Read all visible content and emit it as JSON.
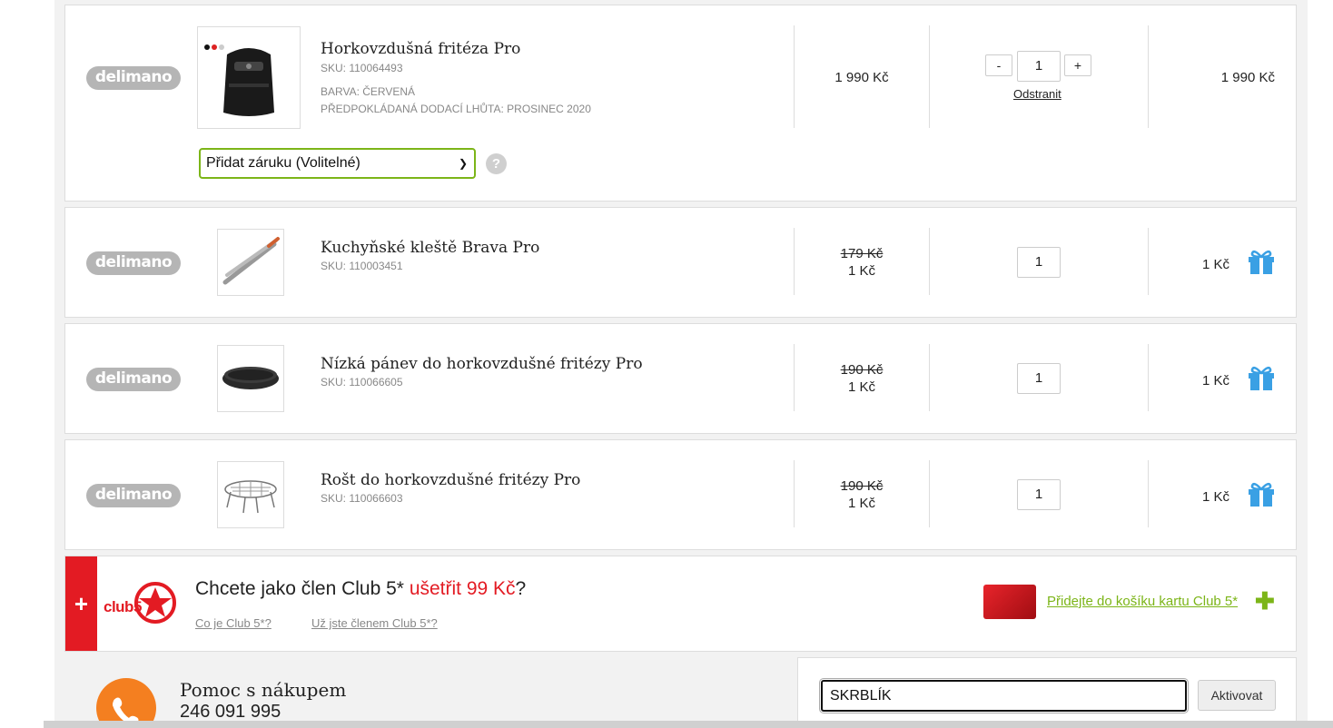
{
  "items": [
    {
      "brand": "delimano",
      "name": "Horkovzdušná fritéza Pro",
      "sku": "SKU: 110064493",
      "color": "BARVA: ČERVENÁ",
      "delivery": "PŘEDPOKLÁDANÁ DODACÍ LHŮTA: PROSINEC 2020",
      "price": "1 990 Kč",
      "qty": "1",
      "minus": "-",
      "plus": "+",
      "remove": "Odstranit",
      "total": "1 990 Kč",
      "warranty": "Přidat záruku (Volitelné)",
      "help": "?"
    },
    {
      "brand": "delimano",
      "name": "Kuchyňské kleště Brava Pro",
      "sku": "SKU: 110003451",
      "old_price": "179 Kč",
      "price": "1 Kč",
      "qty": "1",
      "total": "1 Kč"
    },
    {
      "brand": "delimano",
      "name": "Nízká pánev do horkovzdušné fritézy Pro",
      "sku": "SKU: 110066605",
      "old_price": "190 Kč",
      "price": "1 Kč",
      "qty": "1",
      "total": "1 Kč"
    },
    {
      "brand": "delimano",
      "name": "Rošt do horkovzdušné fritézy Pro",
      "sku": "SKU: 110066603",
      "old_price": "190 Kč",
      "price": "1 Kč",
      "qty": "1",
      "total": "1 Kč"
    }
  ],
  "club": {
    "plus": "+",
    "logo": "club5",
    "title_start": "Chcete jako člen Club 5*",
    "title_save": "ušetřit 99 Kč",
    "title_end": "?",
    "link_what": "Co je Club 5*?",
    "link_member": "Už jste členem Club 5*?",
    "add_card": "Přidejte do košíku kartu Club 5*",
    "add_icon": "✚"
  },
  "help": {
    "title": "Pomoc s nákupem",
    "phone": "246 091 995"
  },
  "voucher": {
    "value": "SKRBLÍK",
    "button": "Aktivovat"
  },
  "colors": {
    "accent_green": "#7cb518",
    "club_red": "#e31b23",
    "gift_blue": "#3aa0e4",
    "phone_orange": "#f47f20"
  }
}
